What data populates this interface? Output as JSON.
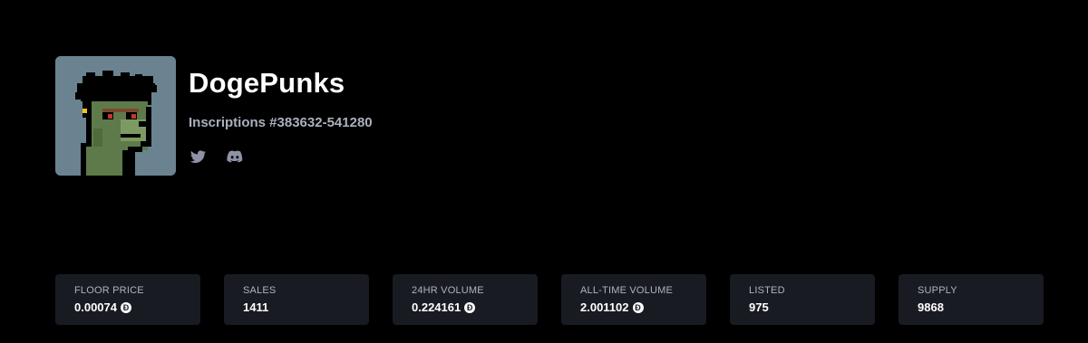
{
  "collection": {
    "name": "DogePunks",
    "inscriptions": "Inscriptions #383632-541280",
    "avatar_icon": "pixel-doge-punk-avatar",
    "socials": [
      {
        "icon": "twitter-icon"
      },
      {
        "icon": "discord-icon"
      }
    ]
  },
  "colors": {
    "background": "#000000",
    "card": "#191b22",
    "muted_text": "#aab0bd",
    "avatar_bg": "#6b8391"
  },
  "stats": [
    {
      "label": "FLOOR PRICE",
      "value": "0.00074",
      "coin": "Ð"
    },
    {
      "label": "SALES",
      "value": "1411"
    },
    {
      "label": "24HR VOLUME",
      "value": "0.224161",
      "coin": "Ð"
    },
    {
      "label": "ALL-TIME VOLUME",
      "value": "2.001102",
      "coin": "Ð"
    },
    {
      "label": "LISTED",
      "value": "975"
    },
    {
      "label": "SUPPLY",
      "value": "9868"
    }
  ]
}
